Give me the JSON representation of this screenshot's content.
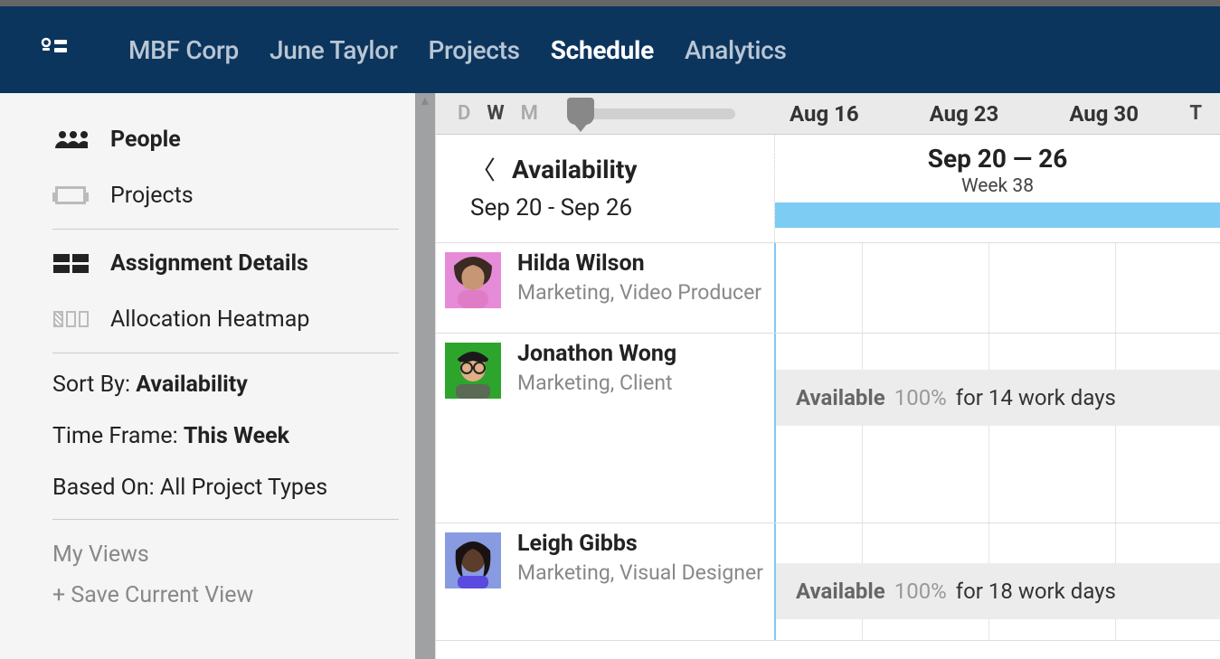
{
  "nav": {
    "items": [
      "MBF Corp",
      "June Taylor",
      "Projects",
      "Schedule",
      "Analytics"
    ],
    "active_index": 3
  },
  "sidebar": {
    "people": "People",
    "projects": "Projects",
    "assignment": "Assignment Details",
    "heatmap": "Allocation Heatmap",
    "filters": {
      "sort_key": "Sort By: ",
      "sort_val": "Availability",
      "frame_key": "Time Frame: ",
      "frame_val": "This Week",
      "based_key": "Based On: ",
      "based_val": "All Project Types"
    },
    "myviews": "My Views",
    "saveview": "+ Save Current View"
  },
  "zoom": {
    "D": "D",
    "W": "W",
    "M": "M",
    "T": "T"
  },
  "date_labels": [
    "Aug 16",
    "Aug 23",
    "Aug 30"
  ],
  "subheader": {
    "title": "Availability",
    "range": "Sep 20 - Sep 26",
    "week_range": "Sep 20 — 26",
    "week_num": "Week 38"
  },
  "people": [
    {
      "name": "Hilda Wilson",
      "roles": "Marketing, Video Producer",
      "avatar": {
        "bg": "#e58bd8",
        "skin": "#c79675",
        "hair": "#3a2a22"
      },
      "availability": null
    },
    {
      "name": "Jonathon Wong",
      "roles": "Marketing, Client",
      "avatar": {
        "bg": "#2da52d",
        "skin": "#dfaf86",
        "hair": "#1a1a1a"
      },
      "availability": {
        "label": "Available",
        "pct": "100%",
        "rest": "for 14 work days"
      }
    },
    {
      "name": "Leigh Gibbs",
      "roles": "Marketing, Visual Designer",
      "avatar": {
        "bg": "#889be0",
        "skin": "#5c3c2a",
        "hair": "#1a1212"
      },
      "availability": {
        "label": "Available",
        "pct": "100%",
        "rest": "for 18 work days"
      }
    }
  ]
}
